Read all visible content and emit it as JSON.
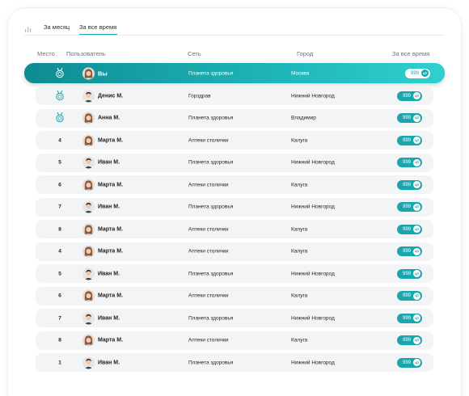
{
  "tabs": {
    "month_label": "За месяц",
    "all_time_label": "За все время",
    "active": "all_time"
  },
  "columns": {
    "place": "Место",
    "user": "Пользователь",
    "network": "Сеть",
    "city": "Город",
    "score": "За все время"
  },
  "coin_label": "ЦП",
  "colors": {
    "accent": "#1aa6ad",
    "accent_dark": "#0e8b92",
    "row_bg": "#f3f4f5"
  },
  "current_user": {
    "place_icon": "medal-icon",
    "avatar": "female",
    "name": "Вы",
    "network": "Планета здоровья",
    "city": "Москва",
    "score": "999"
  },
  "rows": [
    {
      "place": "",
      "place_icon": "medal-icon",
      "avatar": "male",
      "name": "Денис М.",
      "network": "Горздрав",
      "city": "Нижний Новгород",
      "score": "999"
    },
    {
      "place": "",
      "place_icon": "medal-icon",
      "avatar": "female",
      "name": "Анна М.",
      "network": "Планета здоровья",
      "city": "Владимир",
      "score": "999"
    },
    {
      "place": "4",
      "avatar": "female",
      "name": "Марта М.",
      "network": "Аптеки столички",
      "city": "Калуга",
      "score": "999"
    },
    {
      "place": "5",
      "avatar": "male",
      "name": "Иван М.",
      "network": "Планета здоровья",
      "city": "Нижний Новгород",
      "score": "999"
    },
    {
      "place": "6",
      "avatar": "female",
      "name": "Марта М.",
      "network": "Аптеки столички",
      "city": "Калуга",
      "score": "999"
    },
    {
      "place": "7",
      "avatar": "male",
      "name": "Иван М.",
      "network": "Планета здоровья",
      "city": "Нижний Новгород",
      "score": "999"
    },
    {
      "place": "8",
      "avatar": "female",
      "name": "Марта М.",
      "network": "Аптеки столички",
      "city": "Калуга",
      "score": "999"
    },
    {
      "place": "4",
      "avatar": "female",
      "name": "Марта М.",
      "network": "Аптеки столички",
      "city": "Калуга",
      "score": "999"
    },
    {
      "place": "5",
      "avatar": "male",
      "name": "Иван М.",
      "network": "Планета здоровья",
      "city": "Нижний Новгород",
      "score": "999"
    },
    {
      "place": "6",
      "avatar": "female",
      "name": "Марта М.",
      "network": "Аптеки столички",
      "city": "Калуга",
      "score": "999"
    },
    {
      "place": "7",
      "avatar": "male",
      "name": "Иван М.",
      "network": "Планета здоровья",
      "city": "Нижний Новгород",
      "score": "999"
    },
    {
      "place": "8",
      "avatar": "female",
      "name": "Марта М.",
      "network": "Аптеки столички",
      "city": "Калуга",
      "score": "999"
    },
    {
      "place": "1",
      "avatar": "male",
      "name": "Иван М.",
      "network": "Планета здоровья",
      "city": "Нижний Новгород",
      "score": "999"
    }
  ]
}
